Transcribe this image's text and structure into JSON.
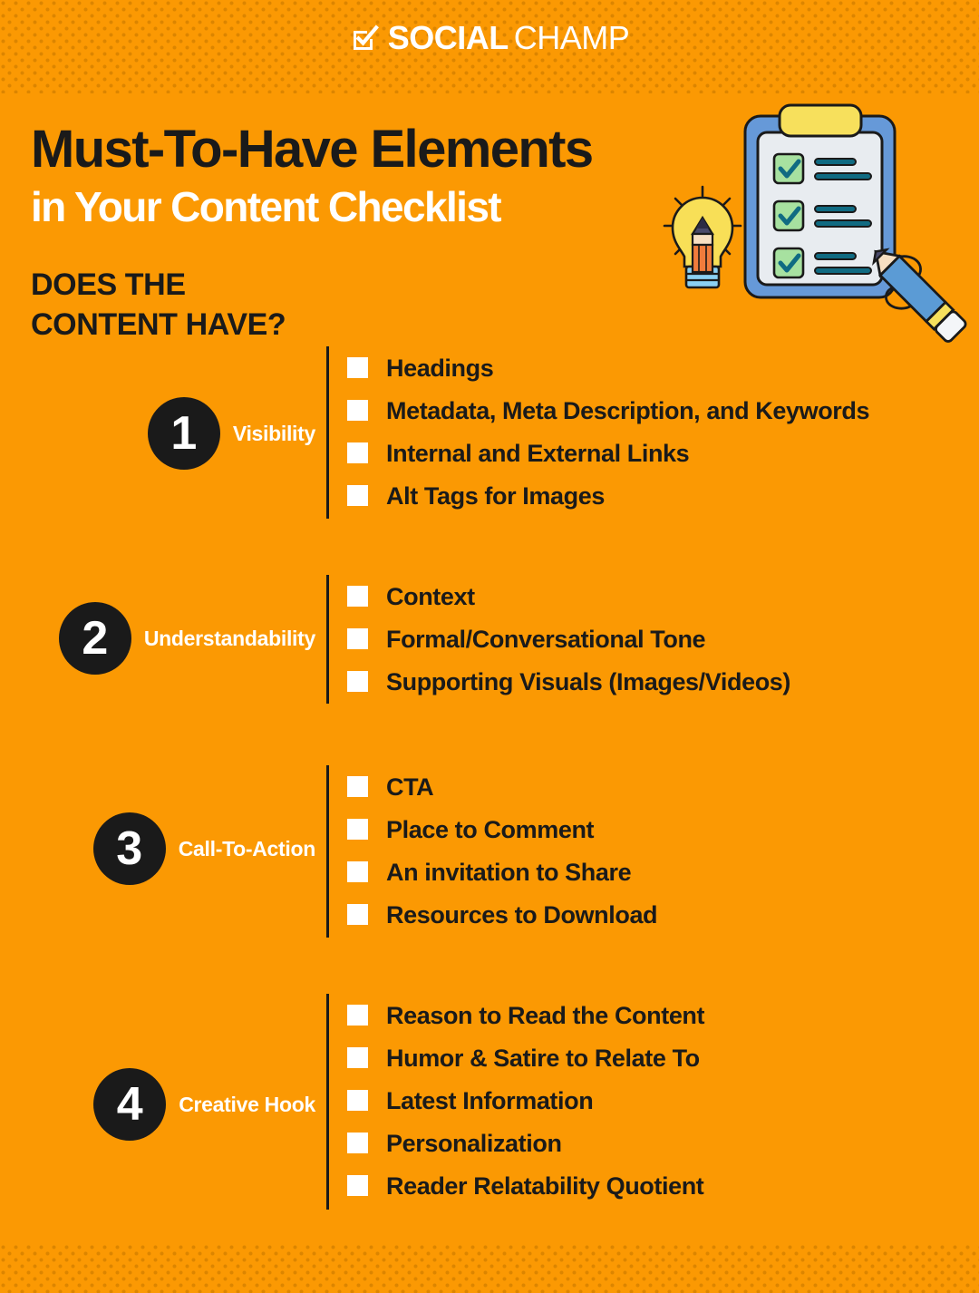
{
  "brand": {
    "logo_icon": "checkbox-check-icon",
    "name_bold": "SOCIAL",
    "name_light": "CHAMP"
  },
  "headline": {
    "line1": "Must-To-Have Elements",
    "line2": "in Your Content Checklist"
  },
  "subhead": {
    "line1": "DOES THE",
    "line2": "CONTENT HAVE?"
  },
  "illustration": {
    "name": "clipboard-checklist-illustration",
    "parts": [
      "clipboard",
      "clip",
      "checkbox-check-1",
      "checkbox-check-2",
      "checkbox-check-3",
      "lightbulb-with-pencil",
      "pencil"
    ]
  },
  "colors": {
    "background": "#FB9903",
    "pattern": "#DC8500",
    "dark": "#1A1A1A",
    "light": "#FFFFFF",
    "clipboard_frame": "#6699D8",
    "clipboard_paper": "#E8ECF0",
    "clip_yellow": "#F7E05C",
    "check_green": "#A7E1A0",
    "check_teal": "#106B82",
    "bulb_yellow": "#F8DF57",
    "pencil_orange": "#F07C3C",
    "pencil_blue": "#5B9BD5"
  },
  "sections": [
    {
      "number": "1",
      "label": "Visibility",
      "items": [
        "Headings",
        "Metadata, Meta Description, and Keywords",
        "Internal and External Links",
        "Alt Tags for Images"
      ]
    },
    {
      "number": "2",
      "label": "Understandability",
      "items": [
        "Context",
        "Formal/Conversational Tone",
        "Supporting Visuals (Images/Videos)"
      ]
    },
    {
      "number": "3",
      "label": "Call-To-Action",
      "items": [
        "CTA",
        "Place to Comment",
        "An invitation to Share",
        "Resources to Download"
      ]
    },
    {
      "number": "4",
      "label": "Creative Hook",
      "items": [
        "Reason to Read the Content",
        "Humor & Satire to Relate To",
        "Latest Information",
        "Personalization",
        "Reader Relatability Quotient"
      ]
    }
  ]
}
